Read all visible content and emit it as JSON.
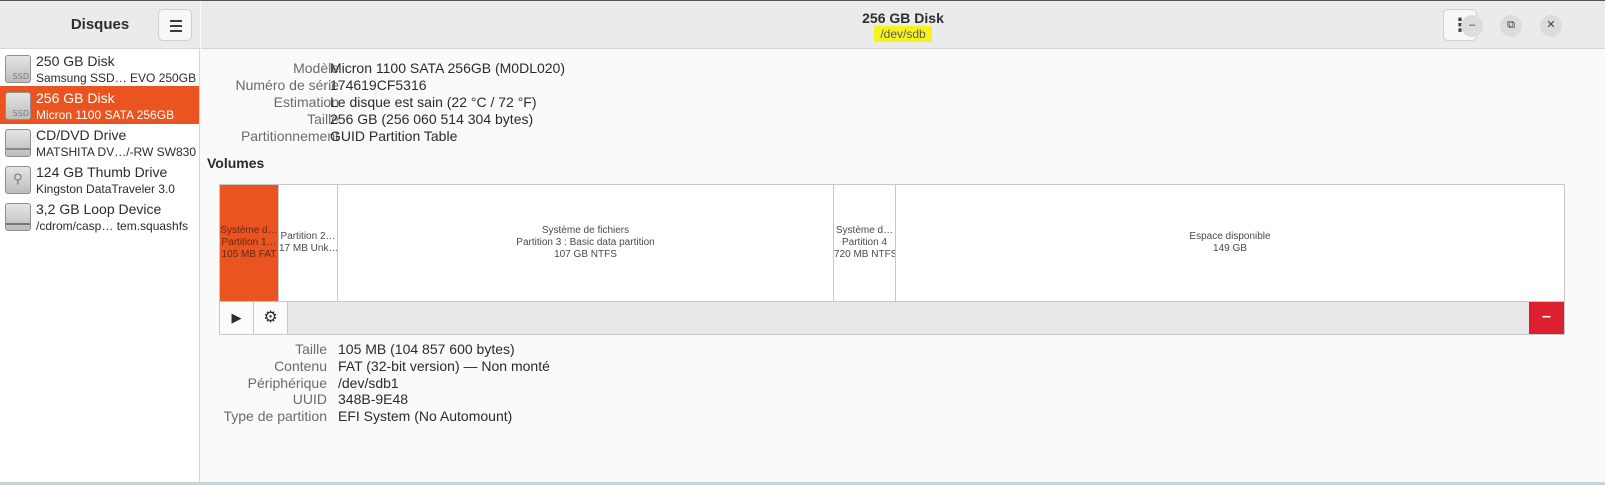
{
  "sidebar": {
    "title": "Disques",
    "menu_icon": "hamburger-icon",
    "disks": [
      {
        "name": "250 GB Disk",
        "sub": "Samsung SSD… EVO 250GB",
        "icon": "ssd-drive-icon",
        "badge": "SSD"
      },
      {
        "name": "256 GB Disk",
        "sub": "Micron 1100 SATA 256GB",
        "icon": "ssd-drive-icon",
        "badge": "SSD",
        "selected": true
      },
      {
        "name": "CD/DVD Drive",
        "sub": "MATSHITA DV…/-RW SW830",
        "icon": "optical-drive-icon"
      },
      {
        "name": "124 GB Thumb Drive",
        "sub": "Kingston DataTraveler 3.0",
        "icon": "usb-drive-icon",
        "glyph": "⚲"
      },
      {
        "name": "3,2 GB Loop Device",
        "sub": "/cdrom/casp… tem.squashfs",
        "icon": "loop-device-icon"
      }
    ]
  },
  "header": {
    "title": "256 GB Disk",
    "subtitle": "/dev/sdb",
    "menu_glyph": "⋮",
    "minimize_glyph": "–",
    "maximize_glyph": "⧉",
    "close_glyph": "✕"
  },
  "disk_info": [
    {
      "label": "Modèle",
      "value": "Micron 1100 SATA 256GB (M0DL020)"
    },
    {
      "label": "Numéro de série",
      "value": "174619CF5316"
    },
    {
      "label": "Estimation",
      "value": "Le disque est sain (22 °C / 72 °F)"
    },
    {
      "label": "Taille",
      "value": "256 GB (256 060 514 304 bytes)"
    },
    {
      "label": "Partitionnement",
      "value": "GUID Partition Table"
    }
  ],
  "volumes": {
    "title": "Volumes",
    "partitions": [
      {
        "line1": "Système d…",
        "line2": "Partition 1…",
        "line3": "105 MB FAT",
        "selected": true
      },
      {
        "line1": "Partition 2…",
        "line2": "17 MB Unk…"
      },
      {
        "line1": "Système de fichiers",
        "line2": "Partition 3 : Basic data partition",
        "line3": "107 GB NTFS"
      },
      {
        "line1": "Système d…",
        "line2": "Partition 4",
        "line3": "720 MB NTFS"
      },
      {
        "line1": "Espace disponible",
        "line2": "149 GB"
      }
    ],
    "toolbar": {
      "play_glyph": "▶",
      "settings_glyph": "⚙",
      "delete_glyph": "–"
    }
  },
  "partition_info": [
    {
      "label": "Taille",
      "value": "105 MB (104 857 600 bytes)"
    },
    {
      "label": "Contenu",
      "value": "FAT (32-bit version) — Non monté"
    },
    {
      "label": "Périphérique",
      "value": "/dev/sdb1"
    },
    {
      "label": "UUID",
      "value": "348B-9E48"
    },
    {
      "label": "Type de partition",
      "value": "EFI System (No Automount)"
    }
  ],
  "colors": {
    "accent": "#e95420",
    "delete": "#dc2032",
    "highlight": "#f7f21d"
  }
}
